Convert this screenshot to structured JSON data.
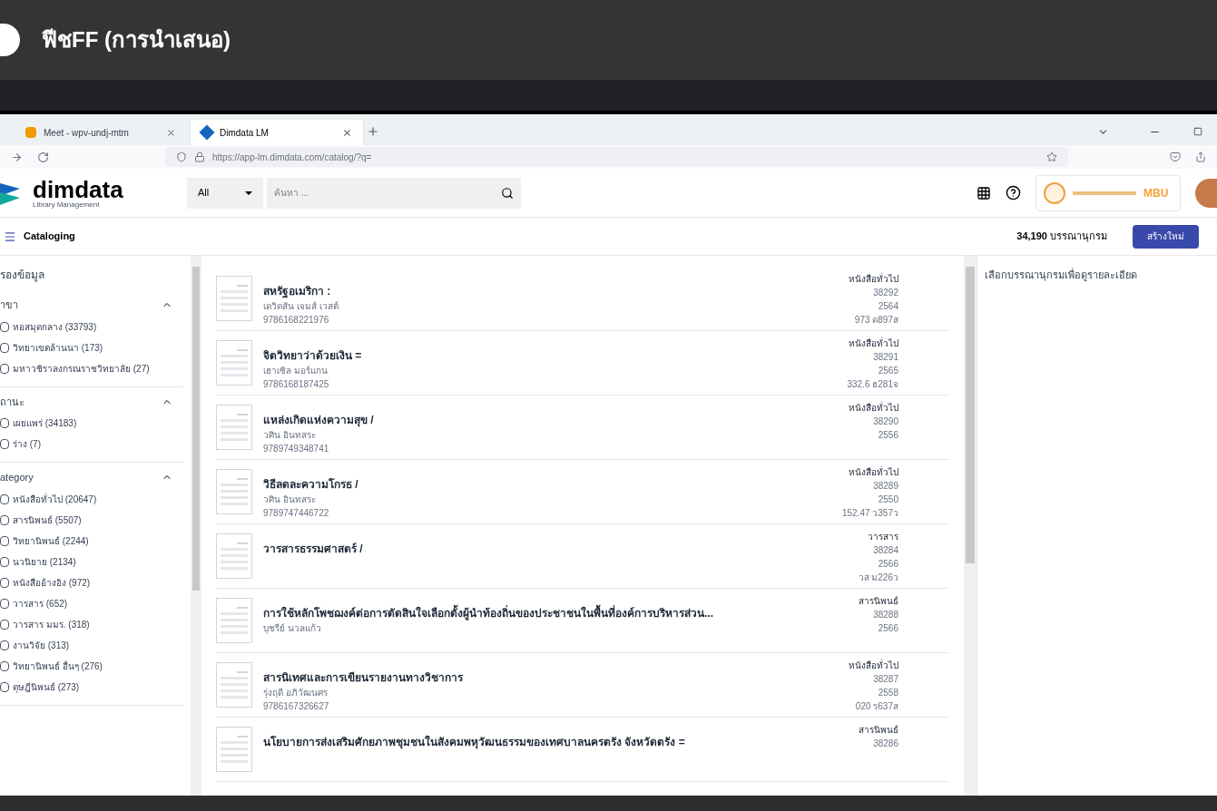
{
  "presentation": {
    "title": "ฟีชFF (การนำเสนอ)"
  },
  "browser": {
    "tabs": [
      {
        "label": "Meet - wpv-undj-mtm",
        "selected": false
      },
      {
        "label": "Dimdata LM",
        "selected": true
      }
    ],
    "url": "https://app-lm.dimdata.com/catalog/?q="
  },
  "header": {
    "logo": "dimdata",
    "logo_sub": "Library Management",
    "scope": "All",
    "search_placeholder": "ค้นหา ...",
    "org": "MBU"
  },
  "toolbar": {
    "title": "Cataloging",
    "count": "34,190 บรรณานุกรม",
    "new_button": "สร้างใหม่"
  },
  "filters": {
    "title": "รองข้อมูล",
    "sections": [
      {
        "title": "าขา",
        "expanded": true,
        "options": [
          {
            "label": "หอสมุดกลาง (33793)",
            "checked": false
          },
          {
            "label": "วิทยาเขตล้านนา (173)",
            "checked": false
          },
          {
            "label": "มหาวชิราลงกรณราชวิทยาลัย (27)",
            "checked": false
          }
        ]
      },
      {
        "title": "ถานะ",
        "expanded": true,
        "options": [
          {
            "label": "เผยแพร่ (34183)",
            "checked": false
          },
          {
            "label": "ร่าง (7)",
            "checked": false
          }
        ]
      },
      {
        "title": "ategory",
        "expanded": true,
        "options": [
          {
            "label": "หนังสือทั่วไป (20647)",
            "checked": false
          },
          {
            "label": "สารนิพนธ์ (5507)",
            "checked": false
          },
          {
            "label": "วิทยานิพนธ์ (2244)",
            "checked": false
          },
          {
            "label": "นวนิยาย (2134)",
            "checked": false
          },
          {
            "label": "หนังสืออ้างอิง (972)",
            "checked": false
          },
          {
            "label": "วารสาร (652)",
            "checked": false
          },
          {
            "label": "วารสาร มมร. (318)",
            "checked": false
          },
          {
            "label": "งานวิจัย (313)",
            "checked": false
          },
          {
            "label": "วิทยานิพนธ์ อื่นๆ (276)",
            "checked": false
          },
          {
            "label": "ดุษฎีนิพนธ์ (273)",
            "checked": false
          }
        ]
      }
    ]
  },
  "records": [
    {
      "title": "สหรัฐอเมริกา :",
      "author": "เดวิดสัน เจมส์ เวสต์",
      "isbn": "9786168221976",
      "type": "หนังสือทั่วไป",
      "id": "38292",
      "year": "2564",
      "call_no": "973 ด897ส"
    },
    {
      "title": "จิตวิทยาว่าด้วยเงิน =",
      "author": "เฮาเซิล มอร์แกน",
      "isbn": "9786168187425",
      "type": "หนังสือทั่วไป",
      "id": "38291",
      "year": "2565",
      "call_no": "332.6 ฮ281จ"
    },
    {
      "title": "แหล่งเกิดแห่งความสุข /",
      "author": "วศิน อินทสระ",
      "isbn": "9789749348741",
      "type": "หนังสือทั่วไป",
      "id": "38290",
      "year": "2556"
    },
    {
      "title": "วิธีลดละความโกรธ /",
      "author": "วศิน อินทสระ",
      "isbn": "9789747446722",
      "type": "หนังสือทั่วไป",
      "id": "38289",
      "year": "2550",
      "call_no": "152.47 ว357ว"
    },
    {
      "title": "วารสารธรรมศาสตร์ /",
      "type": "วารสาร",
      "id": "38284",
      "year": "2566",
      "call_no": "วส ม226ว"
    },
    {
      "title": "การใช้หลักโพชฌงค์ต่อการตัดสินใจเลือกตั้งผู้นำท้องถิ่นของประชาชนในพื้นที่องค์การบริหารส่วน...",
      "author": "บุชรีย์ นวลแก้ว",
      "type": "สารนิพนธ์",
      "id": "38288",
      "year": "2566"
    },
    {
      "title": "สารนิเทศและการเขียนรายงานทางวิชาการ",
      "author": "รุ่งฤดี อภิวัฒนศร",
      "isbn": "9786167326627",
      "type": "หนังสือทั่วไป",
      "id": "38287",
      "year": "2558",
      "call_no": "020 ร637ส"
    },
    {
      "title": "นโยบายการส่งเสริมศักยภาพชุมชนในสังคมพหุวัฒนธรรมของเทศบาลนครตรัง จังหวัดตรัง =",
      "type": "สารนิพนธ์",
      "id": "38286"
    }
  ],
  "detail": {
    "hint": "เลือกบรรณานุกรมเพื่อดูรายละเอียด"
  }
}
